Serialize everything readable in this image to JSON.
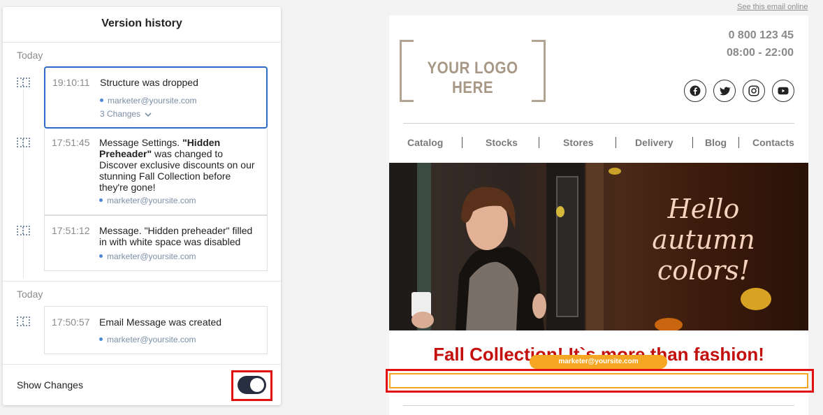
{
  "panel": {
    "title": "Version history",
    "groups": [
      {
        "label": "Today"
      },
      {
        "label": "Today"
      }
    ],
    "entries": [
      {
        "time": "19:10:11",
        "description": "Structure was dropped",
        "user": "marketer@yoursite.com",
        "changes": "3 Changes"
      },
      {
        "time": "17:51:45",
        "desc_prefix": "Message Settings. ",
        "desc_bold": "\"Hidden Preheader\"",
        "desc_suffix": " was changed to Discover exclusive discounts on our stunning Fall Collection before they're gone!",
        "user": "marketer@yoursite.com"
      },
      {
        "time": "17:51:12",
        "description": "Message. \"Hidden preheader\" filled in with white space was disabled",
        "user": "marketer@yoursite.com"
      },
      {
        "time": "17:50:57",
        "description": "Email Message was created",
        "user": "marketer@yoursite.com"
      }
    ],
    "show_changes_label": "Show Changes",
    "show_changes_on": true
  },
  "email": {
    "see_online": "See this email online",
    "logo_text": "YOUR LOGO HERE",
    "phone": "0 800 123 45",
    "hours": "08:00 - 22:00",
    "social_icons": [
      "facebook-icon",
      "twitter-icon",
      "instagram-icon",
      "youtube-icon"
    ],
    "nav": [
      "Catalog",
      "Stocks",
      "Stores",
      "Delivery",
      "Blog",
      "Contacts"
    ],
    "banner_text_lines": [
      "Hello",
      "autumn",
      "colors!"
    ],
    "collection_title": "Fall Collection! It`s more than fashion!",
    "editing_user": "marketer@yoursite.com"
  },
  "colors": {
    "accent_blue": "#2e6bc6",
    "highlight_red": "#e21010",
    "editing_orange": "#f5a623",
    "title_red": "#c40f0f"
  }
}
